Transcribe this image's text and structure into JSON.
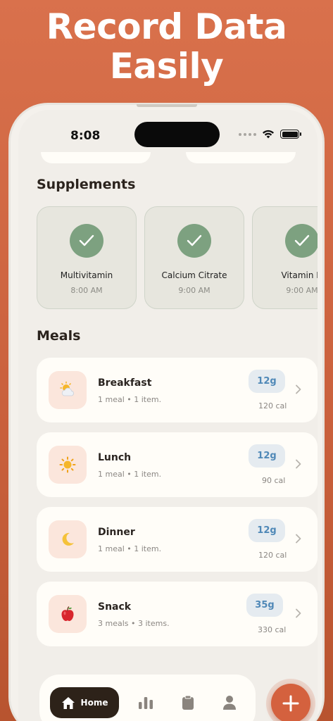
{
  "promo": {
    "line1": "Record Data",
    "line2": "Easily"
  },
  "status": {
    "time": "8:08"
  },
  "supplements": {
    "title": "Supplements",
    "items": [
      {
        "name": "Multivitamin",
        "time": "8:00 AM"
      },
      {
        "name": "Calcium Citrate",
        "time": "9:00 AM"
      },
      {
        "name": "Vitamin D",
        "time": "9:00 AM"
      }
    ]
  },
  "meals": {
    "title": "Meals",
    "items": [
      {
        "name": "Breakfast",
        "summary": "1 meal • 1 item.",
        "protein": "12g",
        "calories": "120 cal",
        "icon": "sun-cloud-icon"
      },
      {
        "name": "Lunch",
        "summary": "1 meal • 1 item.",
        "protein": "12g",
        "calories": "90 cal",
        "icon": "sun-icon"
      },
      {
        "name": "Dinner",
        "summary": "1 meal • 1 item.",
        "protein": "12g",
        "calories": "120 cal",
        "icon": "moon-icon"
      },
      {
        "name": "Snack",
        "summary": "3 meals • 3 items.",
        "protein": "35g",
        "calories": "330 cal",
        "icon": "apple-icon"
      }
    ]
  },
  "tabbar": {
    "home_label": "Home"
  },
  "colors": {
    "accent": "#d4613e",
    "check": "#7da180",
    "protein": "#4f88b7",
    "tab_active": "#2d2219"
  }
}
